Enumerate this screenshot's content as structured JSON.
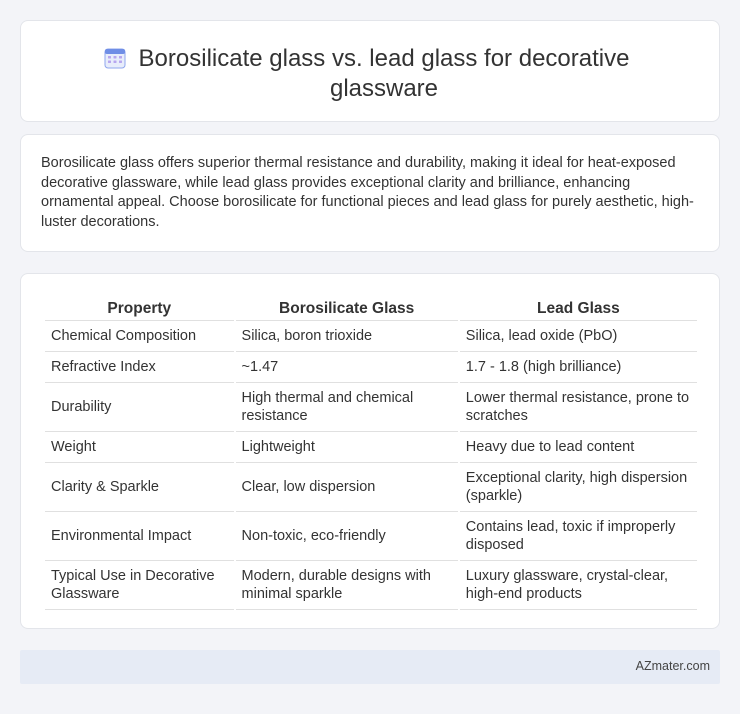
{
  "header": {
    "title": "Borosilicate glass vs. lead glass for decorative glassware",
    "icon": "calendar-icon",
    "icon_color": "#5b7be0"
  },
  "summary": {
    "text": "Borosilicate glass offers superior thermal resistance and durability, making it ideal for heat-exposed decorative glassware, while lead glass provides exceptional clarity and brilliance, enhancing ornamental appeal. Choose borosilicate for functional pieces and lead glass for purely aesthetic, high-luster decorations."
  },
  "table": {
    "headers": [
      "Property",
      "Borosilicate Glass",
      "Lead Glass"
    ],
    "rows": [
      [
        "Chemical Composition",
        "Silica, boron trioxide",
        "Silica, lead oxide (PbO)"
      ],
      [
        "Refractive Index",
        "~1.47",
        "1.7 - 1.8 (high brilliance)"
      ],
      [
        "Durability",
        "High thermal and chemical resistance",
        "Lower thermal resistance, prone to scratches"
      ],
      [
        "Weight",
        "Lightweight",
        "Heavy due to lead content"
      ],
      [
        "Clarity & Sparkle",
        "Clear, low dispersion",
        "Exceptional clarity, high dispersion (sparkle)"
      ],
      [
        "Environmental Impact",
        "Non-toxic, eco-friendly",
        "Contains lead, toxic if improperly disposed"
      ],
      [
        "Typical Use in Decorative Glassware",
        "Modern, durable designs with minimal sparkle",
        "Luxury glassware, crystal-clear, high-end products"
      ]
    ]
  },
  "footer": {
    "brand": "AZmater.com"
  }
}
